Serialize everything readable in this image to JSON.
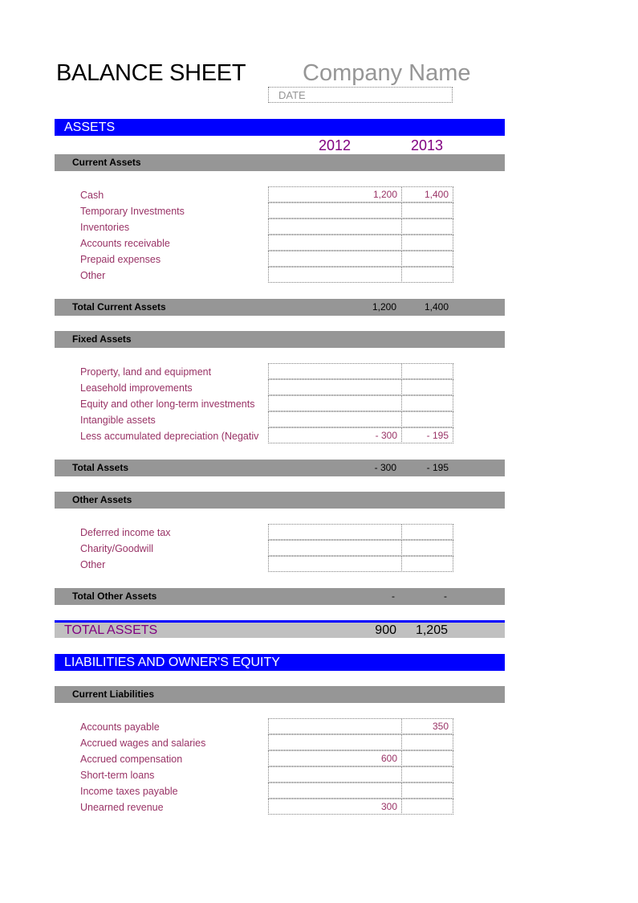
{
  "header": {
    "title": "BALANCE SHEET",
    "company": "Company Name",
    "date_placeholder": "DATE"
  },
  "colors": {
    "section_bar": "#0000ff",
    "subheader_bar": "#969696",
    "total_bar": "#c0c0c0",
    "label_text": "#993366",
    "year_text": "#800080"
  },
  "years": [
    "2012",
    "2013"
  ],
  "assets": {
    "title": "ASSETS",
    "current": {
      "header": "Current Assets",
      "rows": [
        {
          "label": "Cash",
          "v2012": "1,200",
          "v2013": "1,400"
        },
        {
          "label": "Temporary Investments",
          "v2012": "",
          "v2013": ""
        },
        {
          "label": "Inventories",
          "v2012": "",
          "v2013": ""
        },
        {
          "label": "Accounts receivable",
          "v2012": "",
          "v2013": ""
        },
        {
          "label": "Prepaid expenses",
          "v2012": "",
          "v2013": ""
        },
        {
          "label": "Other",
          "v2012": "",
          "v2013": ""
        }
      ],
      "total_label": "Total Current Assets",
      "total_2012": "1,200",
      "total_2013": "1,400"
    },
    "fixed": {
      "header": "Fixed Assets",
      "rows": [
        {
          "label": "Property, land and equipment",
          "v2012": "",
          "v2013": ""
        },
        {
          "label": "Leasehold improvements",
          "v2012": "",
          "v2013": ""
        },
        {
          "label": "Equity and other long-term investments",
          "v2012": "",
          "v2013": ""
        },
        {
          "label": "Intangible assets",
          "v2012": "",
          "v2013": ""
        },
        {
          "label": "Less accumulated depreciation (Negativ",
          "v2012": "- 300",
          "v2013": "- 195"
        }
      ],
      "total_label": "Total Assets",
      "total_2012": "- 300",
      "total_2013": "- 195"
    },
    "other": {
      "header": "Other Assets",
      "rows": [
        {
          "label": "Deferred income tax",
          "v2012": "",
          "v2013": ""
        },
        {
          "label": "Charity/Goodwill",
          "v2012": "",
          "v2013": ""
        },
        {
          "label": "Other",
          "v2012": "",
          "v2013": ""
        }
      ],
      "total_label": "Total Other Assets",
      "total_2012": "-",
      "total_2013": "-"
    },
    "grand_total_label": "TOTAL ASSETS",
    "grand_total_2012": "900",
    "grand_total_2013": "1,205"
  },
  "liabilities": {
    "title": "LIABILITIES AND OWNER'S EQUITY",
    "current": {
      "header": "Current Liabilities",
      "rows": [
        {
          "label": "Accounts payable",
          "v2012": "",
          "v2013": "350"
        },
        {
          "label": "Accrued wages and salaries",
          "v2012": "",
          "v2013": ""
        },
        {
          "label": "Accrued compensation",
          "v2012": "600",
          "v2013": ""
        },
        {
          "label": "Short-term loans",
          "v2012": "",
          "v2013": ""
        },
        {
          "label": "Income taxes payable",
          "v2012": "",
          "v2013": ""
        },
        {
          "label": "Unearned revenue",
          "v2012": "300",
          "v2013": ""
        }
      ]
    }
  }
}
